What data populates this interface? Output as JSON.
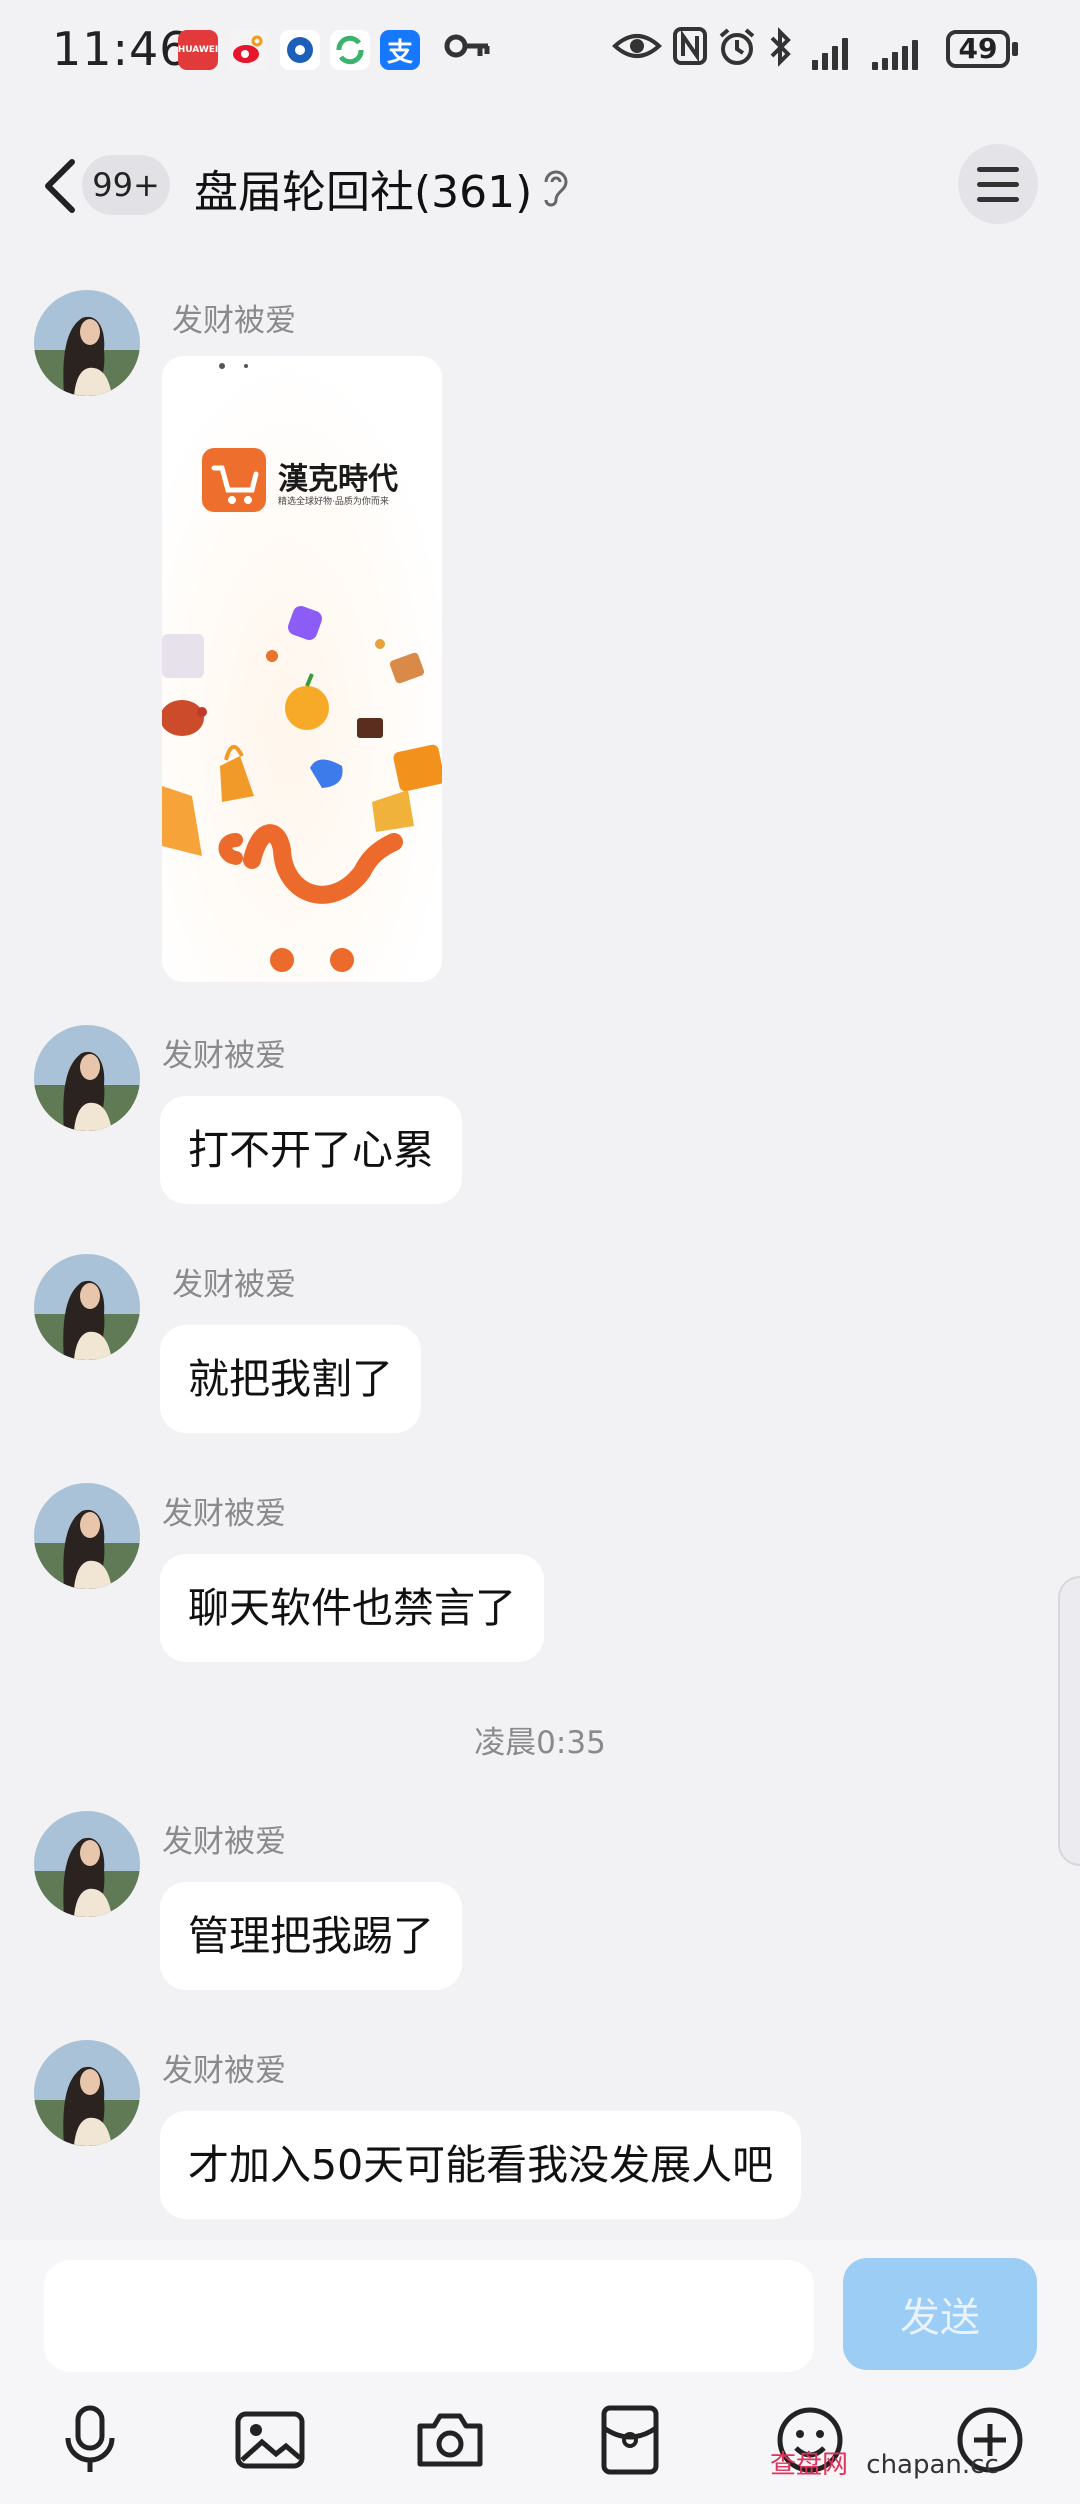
{
  "status_bar": {
    "time": "11:46",
    "battery": "49"
  },
  "header": {
    "unread_badge": "99+",
    "title": "盘届轮回社(361)"
  },
  "messages": [
    {
      "sender": "发财被爱",
      "type": "image",
      "image_title": "漢克時代",
      "image_subtitle": "精选全球好物·品质为你而来"
    },
    {
      "sender": "发财被爱",
      "type": "text",
      "text": "打不开了心累"
    },
    {
      "sender": "发财被爱",
      "type": "text",
      "text": "就把我割了"
    },
    {
      "sender": "发财被爱",
      "type": "text",
      "text": "聊天软件也禁言了"
    },
    {
      "sender": "发财被爱",
      "type": "text",
      "text": "管理把我踢了"
    },
    {
      "sender": "发财被爱",
      "type": "text",
      "text": "才加入50天可能看我没发展人吧"
    }
  ],
  "timestamp": "凌晨0:35",
  "composer": {
    "send_label": "发送",
    "input_value": ""
  },
  "watermark": {
    "cn": "查盘网",
    "en": "chapan.cc"
  },
  "colors": {
    "background": "#f2f2f4",
    "bubble": "#ffffff",
    "send_button": "#9ccdf5",
    "brand_orange": "#ee6f2d"
  }
}
